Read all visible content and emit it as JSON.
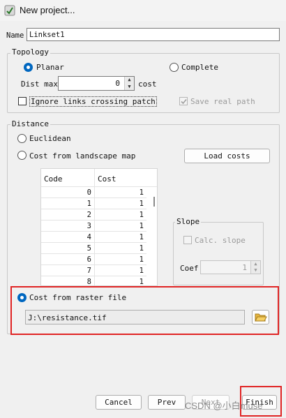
{
  "window": {
    "title": "New project..."
  },
  "name": {
    "label": "Name",
    "value": "Linkset1"
  },
  "topology": {
    "legend": "Topology",
    "planar_label": "Planar",
    "complete_label": "Complete",
    "selected": "planar",
    "dist_max_label": "Dist max",
    "dist_max_value": "0",
    "cost_unit": "cost",
    "ignore_links_label": "Ignore links crossing patch",
    "save_real_path_label": "Save real path"
  },
  "distance": {
    "legend": "Distance",
    "euclidean_label": "Euclidean",
    "landscape_label": "Cost from landscape map",
    "load_costs_label": "Load costs",
    "table": {
      "headers": [
        "Code",
        "Cost"
      ],
      "rows": [
        [
          "0",
          "1"
        ],
        [
          "1",
          "1"
        ],
        [
          "2",
          "1"
        ],
        [
          "3",
          "1"
        ],
        [
          "4",
          "1"
        ],
        [
          "5",
          "1"
        ],
        [
          "6",
          "1"
        ],
        [
          "7",
          "1"
        ],
        [
          "8",
          "1"
        ]
      ]
    },
    "slope": {
      "legend": "Slope",
      "calc_label": "Calc. slope",
      "coef_label": "Coef",
      "coef_value": "1"
    },
    "raster_label": "Cost from raster file",
    "raster_path": "J:\\resistance.tif",
    "selected": "raster"
  },
  "buttons": {
    "cancel": "Cancel",
    "prev": "Prev",
    "next": "Next",
    "finish": "Finish"
  },
  "watermark": "CSDN @小白muse",
  "colors": {
    "accent": "#0067c0",
    "highlight": "#e02424"
  }
}
